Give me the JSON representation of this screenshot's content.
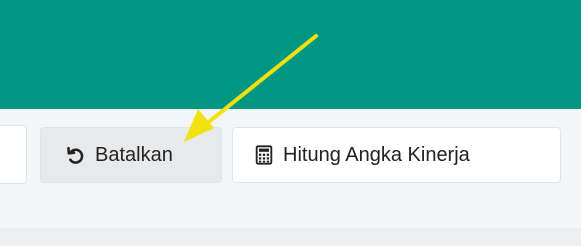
{
  "toolbar": {
    "cancel_label": "Batalkan",
    "cancel_icon": "undo-icon",
    "calculate_label": "Hitung Angka Kinerja",
    "calculate_icon": "calculator-icon"
  },
  "colors": {
    "header": "#009782",
    "background": "#f4f5f7",
    "annotation_arrow": "#f0e10f"
  }
}
